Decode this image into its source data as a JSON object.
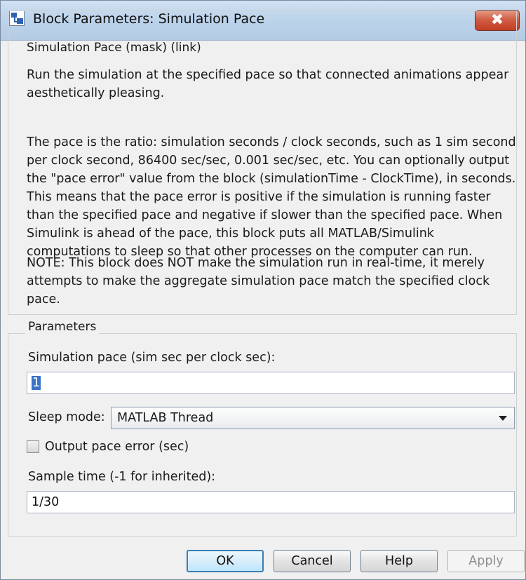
{
  "window": {
    "title": "Block Parameters: Simulation Pace",
    "close_glyph": "✖"
  },
  "description": {
    "group_title": "Simulation Pace (mask) (link)",
    "paragraphs": [
      "Run the simulation at the specified pace so that connected animations appear aesthetically pleasing.",
      "The pace is the ratio: simulation seconds / clock seconds, such as 1 sim second per clock second, 86400 sec/sec, 0.001 sec/sec, etc.  You can optionally output the \"pace error\" value from the block (simulationTime - ClockTime), in seconds.  This means that the pace error is positive if the simulation is running faster than the specified pace and negative if slower than the specified pace.  When Simulink is ahead of the pace, this block puts all MATLAB/Simulink computations to sleep so that other processes on the computer can run.",
      "NOTE:  This block does NOT make the simulation run in real-time, it merely attempts to make the aggregate simulation pace match the specified clock pace."
    ]
  },
  "parameters": {
    "group_title": "Parameters",
    "pace_label": "Simulation pace (sim sec per clock sec):",
    "pace_value": "1",
    "sleep_label": "Sleep mode:",
    "sleep_value": "MATLAB Thread",
    "output_error_label": "Output pace error (sec)",
    "output_error_checked": false,
    "sample_label": "Sample time (-1 for inherited):",
    "sample_value": "1/30"
  },
  "buttons": {
    "ok": "OK",
    "cancel": "Cancel",
    "help": "Help",
    "apply": "Apply"
  },
  "icons": {
    "app": "simulink-block-icon",
    "close": "close-icon",
    "dropdown": "chevron-down-icon"
  },
  "colors": {
    "title_bar": "#bcd3ea",
    "close_button": "#c94a30",
    "selection": "#3b73c9",
    "dialog_bg": "#f0f0f0"
  }
}
